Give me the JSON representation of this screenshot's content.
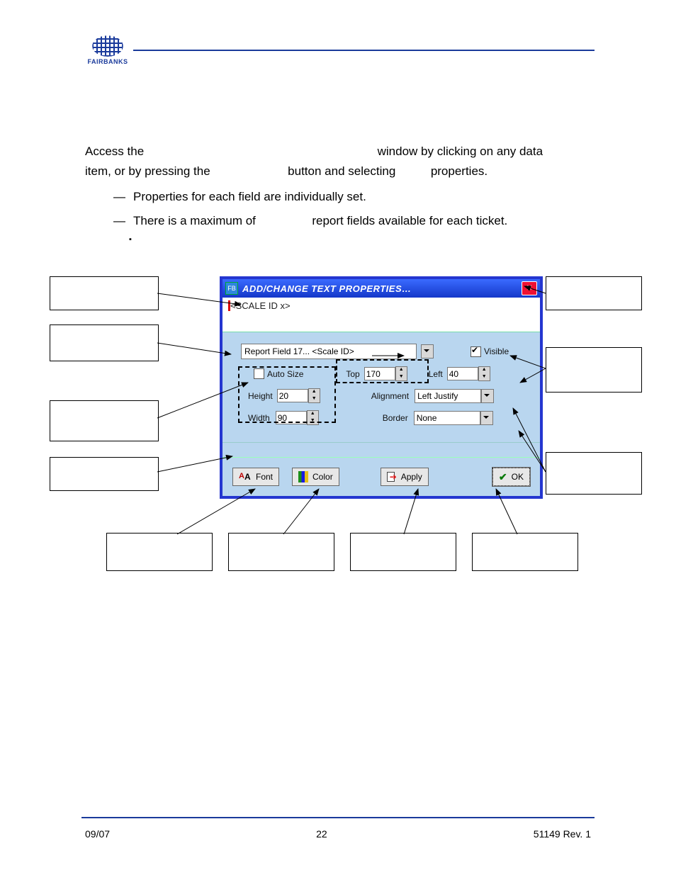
{
  "logo_text": "FAIRBANKS",
  "para": {
    "t1": "Access the",
    "t2": "window by clicking on any data",
    "t3": "item, or by pressing the",
    "t4": "button and selecting",
    "t5": "properties."
  },
  "bullets": {
    "b1": "Properties for each field are individually set.",
    "b2a": "There is a maximum of",
    "b2b": "report fields available for each ticket."
  },
  "dialog": {
    "title": "ADD/CHANGE TEXT PROPERTIES…",
    "preview": "<SCALE ID  x>",
    "report_field": "Report Field 17... <Scale ID>",
    "visible_label": "Visible",
    "visible_checked": true,
    "auto_size_label": "Auto Size",
    "auto_size_checked": false,
    "top_label": "Top",
    "top_value": "170",
    "left_label": "Left",
    "left_value": "40",
    "height_label": "Height",
    "height_value": "20",
    "width_label": "Width",
    "width_value": "90",
    "alignment_label": "Alignment",
    "alignment_value": "Left Justify",
    "border_label": "Border",
    "border_value": "None",
    "font_btn": "Font",
    "color_btn": "Color",
    "apply_btn": "Apply",
    "ok_btn": "OK"
  },
  "footer": {
    "left": "09/07",
    "center": "22",
    "right": "51149   Rev. 1"
  }
}
